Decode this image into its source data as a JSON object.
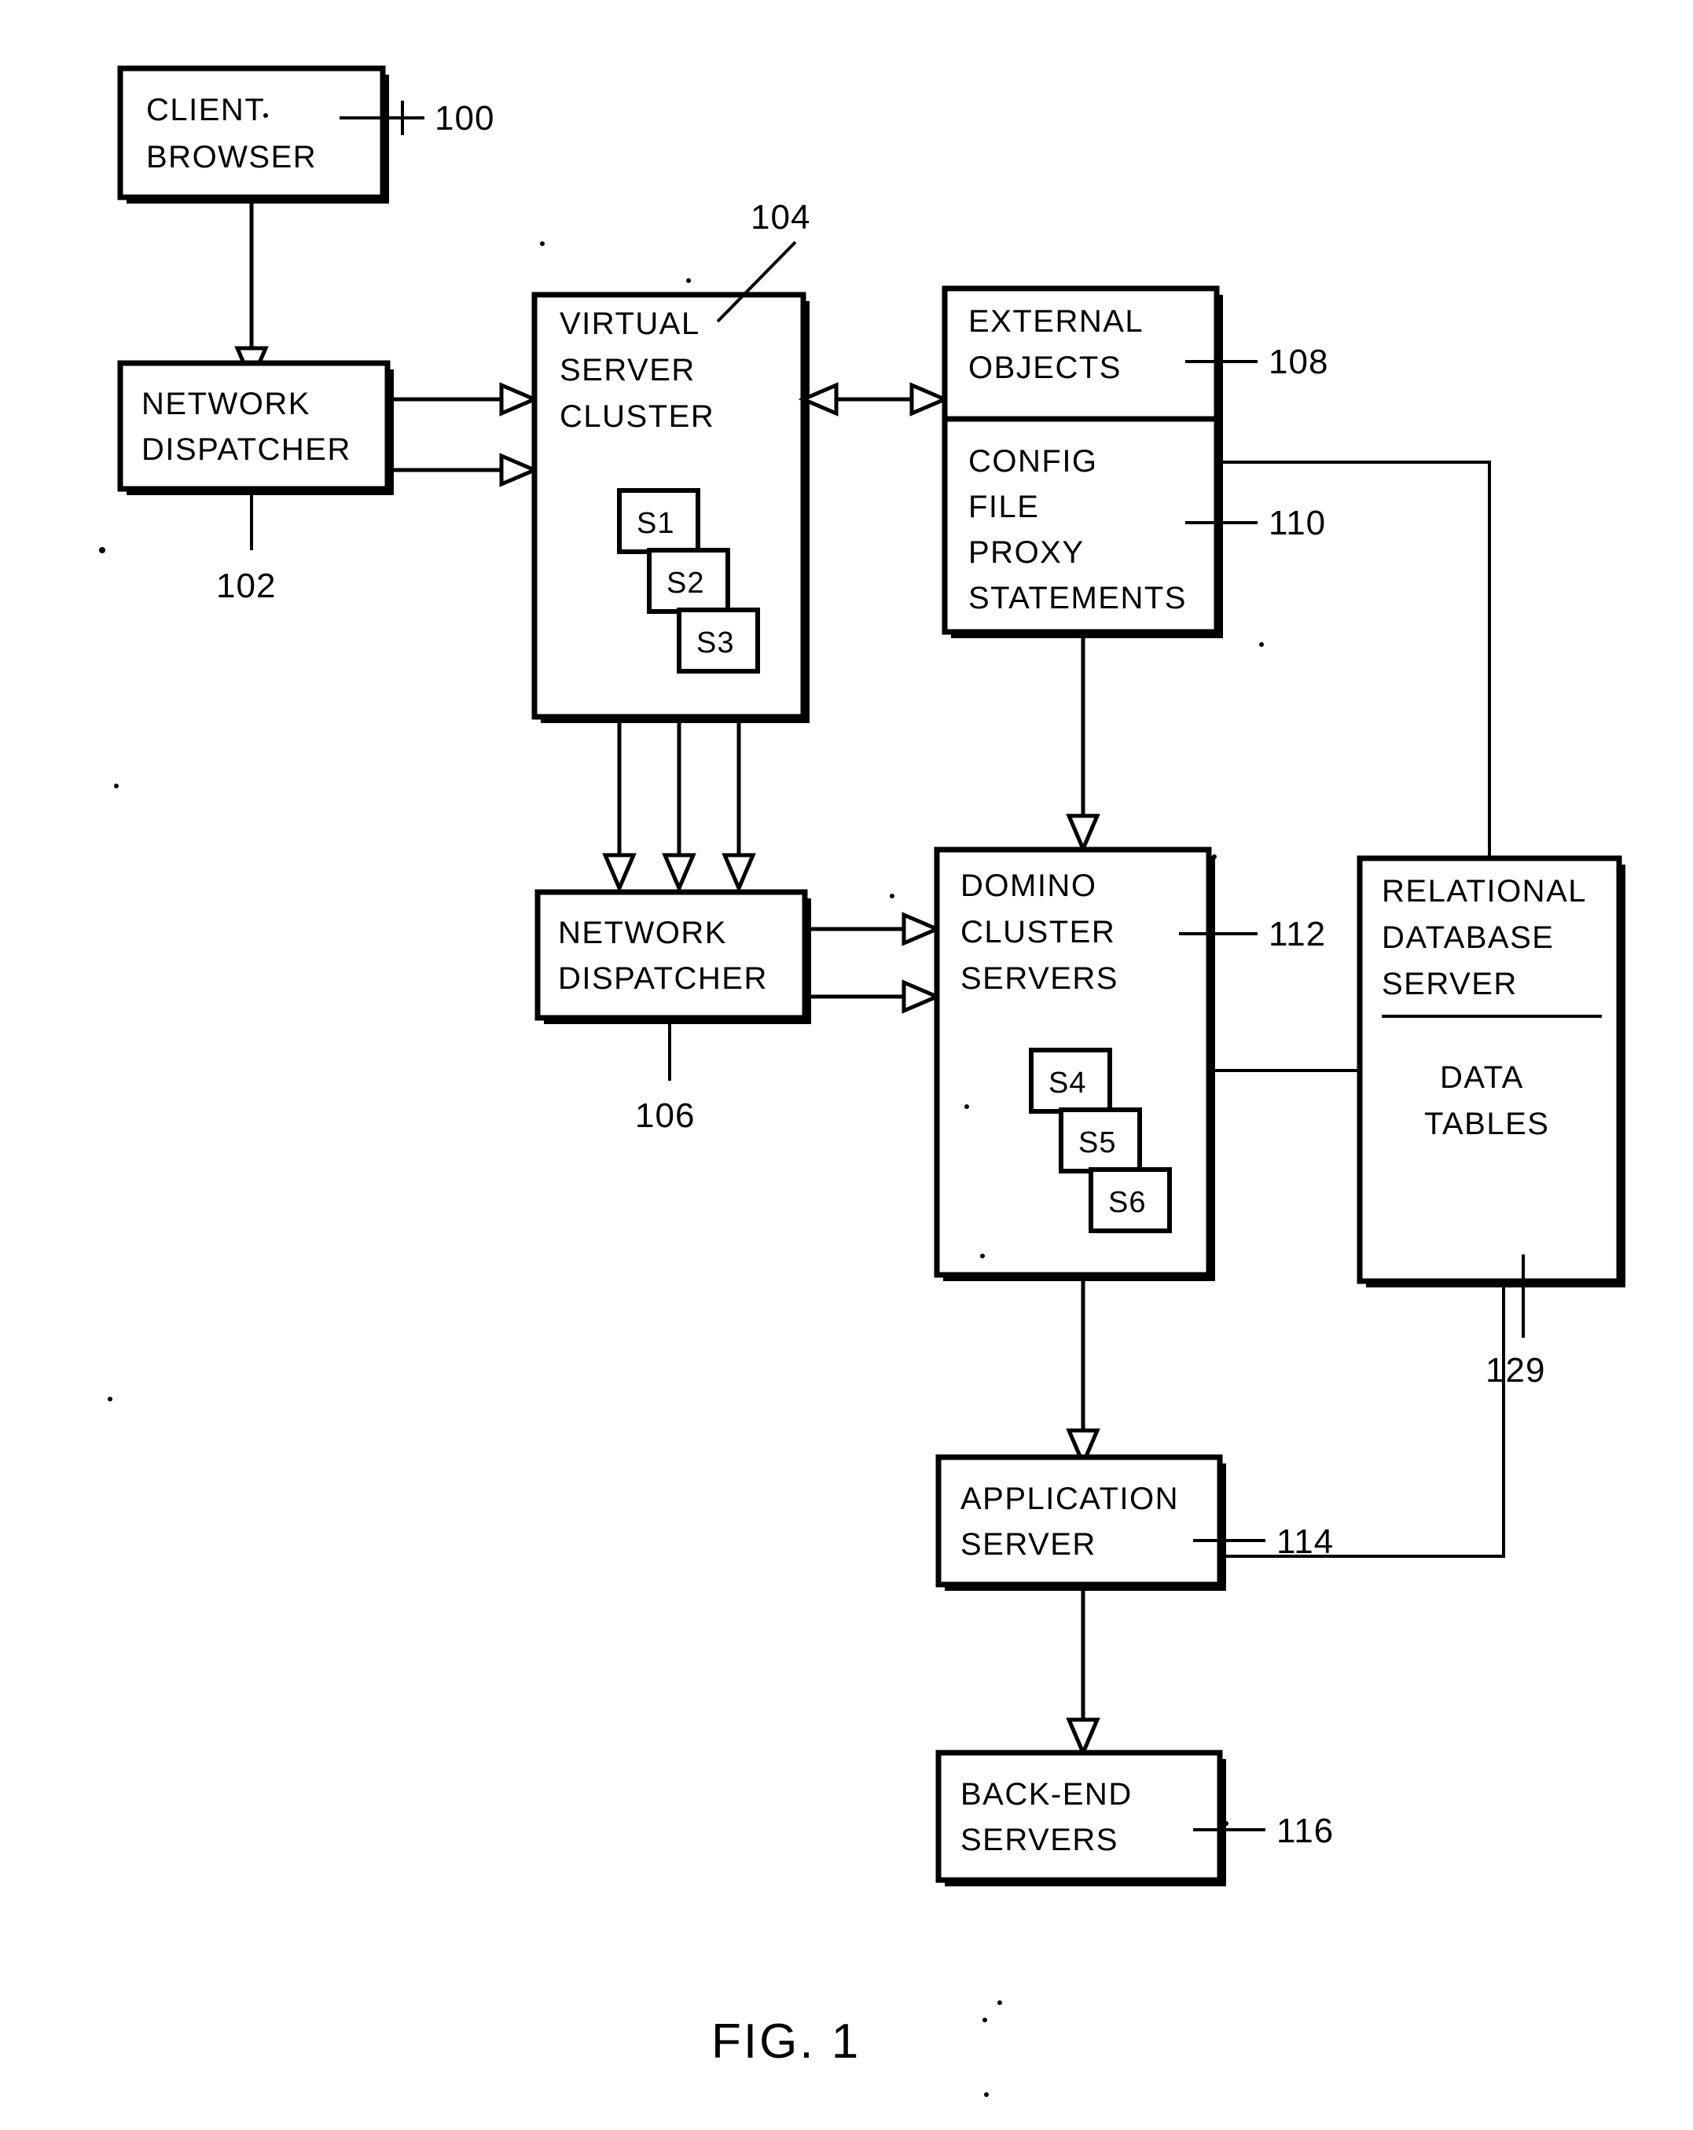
{
  "figure": {
    "caption": "FIG. 1",
    "title": "Clustered web server architecture block diagram"
  },
  "blocks": {
    "client_browser": {
      "lines": [
        "CLIENT",
        "BROWSER"
      ],
      "ref": "100"
    },
    "network_dispatcher_1": {
      "lines": [
        "NETWORK",
        "DISPATCHER"
      ],
      "ref": "102"
    },
    "virtual_server_cluster": {
      "lines": [
        "VIRTUAL",
        "SERVER",
        "CLUSTER"
      ],
      "ref": "104",
      "servers": [
        "S1",
        "S2",
        "S3"
      ]
    },
    "external_objects": {
      "lines": [
        "EXTERNAL",
        "OBJECTS"
      ],
      "ref": "108"
    },
    "config_file": {
      "lines": [
        "CONFIG",
        "FILE",
        "PROXY",
        "STATEMENTS"
      ],
      "ref": "110"
    },
    "network_dispatcher_2": {
      "lines": [
        "NETWORK",
        "DISPATCHER"
      ],
      "ref": "106"
    },
    "domino_cluster_servers": {
      "lines": [
        "DOMINO",
        "CLUSTER",
        "SERVERS"
      ],
      "ref": "112",
      "servers": [
        "S4",
        "S5",
        "S6"
      ]
    },
    "relational_database_server": {
      "lines": [
        "RELATIONAL",
        "DATABASE",
        "SERVER"
      ],
      "data_lines": [
        "DATA",
        "TABLES"
      ],
      "ref": "129"
    },
    "application_server": {
      "lines": [
        "APPLICATION",
        "SERVER"
      ],
      "ref": "114"
    },
    "back_end_servers": {
      "lines": [
        "BACK-END",
        "SERVERS"
      ],
      "ref": "116"
    }
  },
  "colors": {
    "ink": "#000000",
    "paper": "#ffffff"
  }
}
